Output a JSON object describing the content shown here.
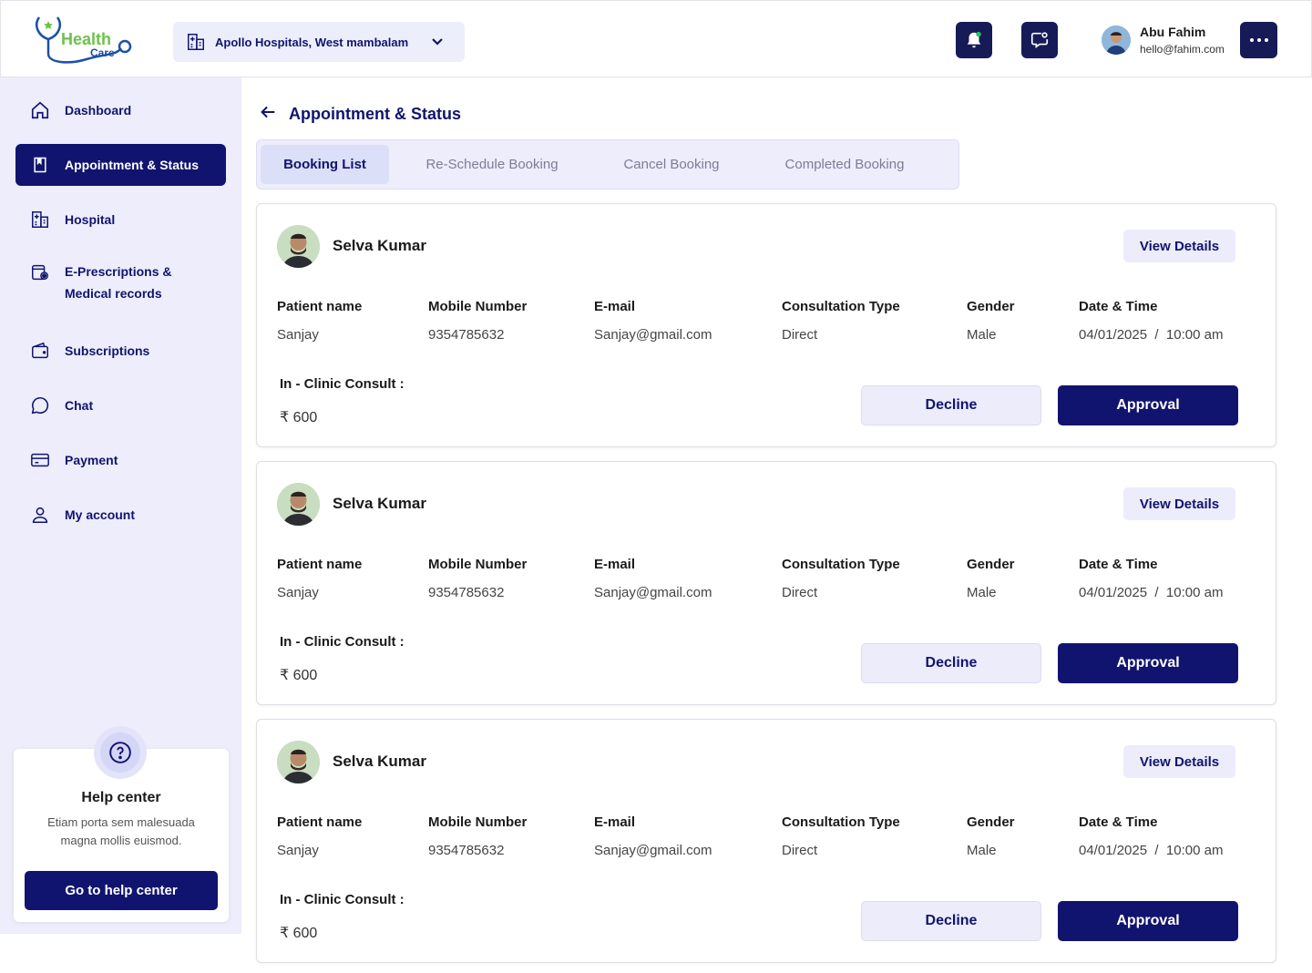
{
  "brand": {
    "line1": "Health",
    "line2": "Care",
    "color_primary": "#11146e",
    "color_green": "#6cc24a"
  },
  "header": {
    "hospital": "Apollo Hospitals, West mambalam",
    "notification_icon": "bell-icon",
    "chat_icon": "chat-bubble-icon",
    "user": {
      "name": "Abu Fahim",
      "email": "hello@fahim.com"
    },
    "more_icon": "more-dots-icon"
  },
  "sidebar": {
    "items": [
      {
        "label": "Dashboard",
        "icon": "home-icon",
        "active": false
      },
      {
        "label": "Appointment & Status",
        "icon": "bookmark-icon",
        "active": true
      },
      {
        "label": "Hospital",
        "icon": "hospital-icon",
        "active": false
      },
      {
        "label": "E-Prescriptions & Medical records",
        "icon": "prescription-icon",
        "active": false
      },
      {
        "label": "Subscriptions",
        "icon": "wallet-icon",
        "active": false
      },
      {
        "label": "Chat",
        "icon": "chat-icon",
        "active": false
      },
      {
        "label": "Payment",
        "icon": "card-icon",
        "active": false
      },
      {
        "label": "My account",
        "icon": "user-icon",
        "active": false
      }
    ],
    "help": {
      "title": "Help center",
      "description": "Etiam porta sem malesuada magna mollis euismod.",
      "button": "Go to help center"
    }
  },
  "main": {
    "title": "Appointment & Status",
    "tabs": [
      {
        "label": "Booking List",
        "active": true
      },
      {
        "label": "Re-Schedule Booking",
        "active": false
      },
      {
        "label": "Cancel Booking",
        "active": false
      },
      {
        "label": "Completed Booking",
        "active": false
      }
    ],
    "columns": [
      "Patient name",
      "Mobile Number",
      "E-mail",
      "Consultation Type",
      "Gender",
      "Date & Time"
    ],
    "consult_label": "In - Clinic Consult :",
    "view_label": "View Details",
    "decline_label": "Decline",
    "approve_label": "Approval",
    "bookings": [
      {
        "doctor": "Selva Kumar",
        "patient": "Sanjay",
        "mobile": "9354785632",
        "email": "Sanjay@gmail.com",
        "type": "Direct",
        "gender": "Male",
        "datetime": "04/01/2025  /  10:00 am",
        "fee": "₹ 600"
      },
      {
        "doctor": "Selva Kumar",
        "patient": "Sanjay",
        "mobile": "9354785632",
        "email": "Sanjay@gmail.com",
        "type": "Direct",
        "gender": "Male",
        "datetime": "04/01/2025  /  10:00 am",
        "fee": "₹ 600"
      },
      {
        "doctor": "Selva Kumar",
        "patient": "Sanjay",
        "mobile": "9354785632",
        "email": "Sanjay@gmail.com",
        "type": "Direct",
        "gender": "Male",
        "datetime": "04/01/2025  /  10:00 am",
        "fee": "₹ 600"
      }
    ]
  }
}
